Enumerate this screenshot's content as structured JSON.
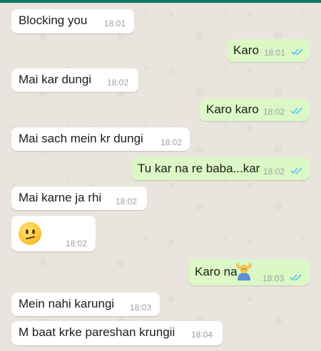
{
  "messages": [
    {
      "text": "Blocking you",
      "time": "18:01"
    },
    {
      "text": "Karo",
      "time": "18:01"
    },
    {
      "text": "Mai kar dungi",
      "time": "18:02"
    },
    {
      "text": "Karo karo",
      "time": "18:02"
    },
    {
      "text": "Mai sach mein kr dungi",
      "time": "18:02"
    },
    {
      "text": "Tu kar na re baba...kar",
      "time": "18:02"
    },
    {
      "text": "Mai karne ja rhi",
      "time": "18:02"
    },
    {
      "emoji": "confused-face-emoji",
      "time": "18:02"
    },
    {
      "text": "Karo na",
      "emoji": "person-gesturing-emoji",
      "time": "18:03"
    },
    {
      "text": "Mein nahi karungi",
      "time": "18:03"
    },
    {
      "text": "M baat krke pareshan krungii",
      "time": "18:04"
    }
  ],
  "colors": {
    "incoming_bubble": "#ffffff",
    "outgoing_bubble": "#dcf8c6",
    "read_ticks": "#4fc3f7",
    "chat_background": "#e9e4dd"
  }
}
